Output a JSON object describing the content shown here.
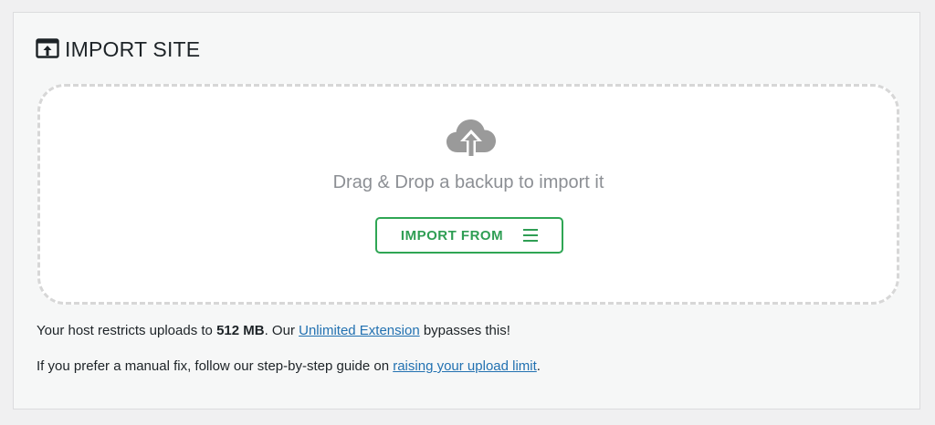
{
  "header": {
    "title": "IMPORT SITE",
    "icon": "import-site-icon"
  },
  "dropzone": {
    "icon": "cloud-upload-icon",
    "text": "Drag & Drop a backup to import it",
    "button_label": "IMPORT FROM",
    "button_icon": "menu-icon"
  },
  "info": {
    "line1_prefix": "Your host restricts uploads to ",
    "limit": "512 MB",
    "line1_mid": ". Our ",
    "extension_link": "Unlimited Extension",
    "line1_suffix": " bypasses this!",
    "line2_prefix": "If you prefer a manual fix, follow our step-by-step guide on ",
    "guide_link": "raising your upload limit",
    "line2_suffix": "."
  },
  "colors": {
    "accent_green": "#2fa654",
    "link_blue": "#2271b1",
    "muted_text": "#8c8f94"
  }
}
